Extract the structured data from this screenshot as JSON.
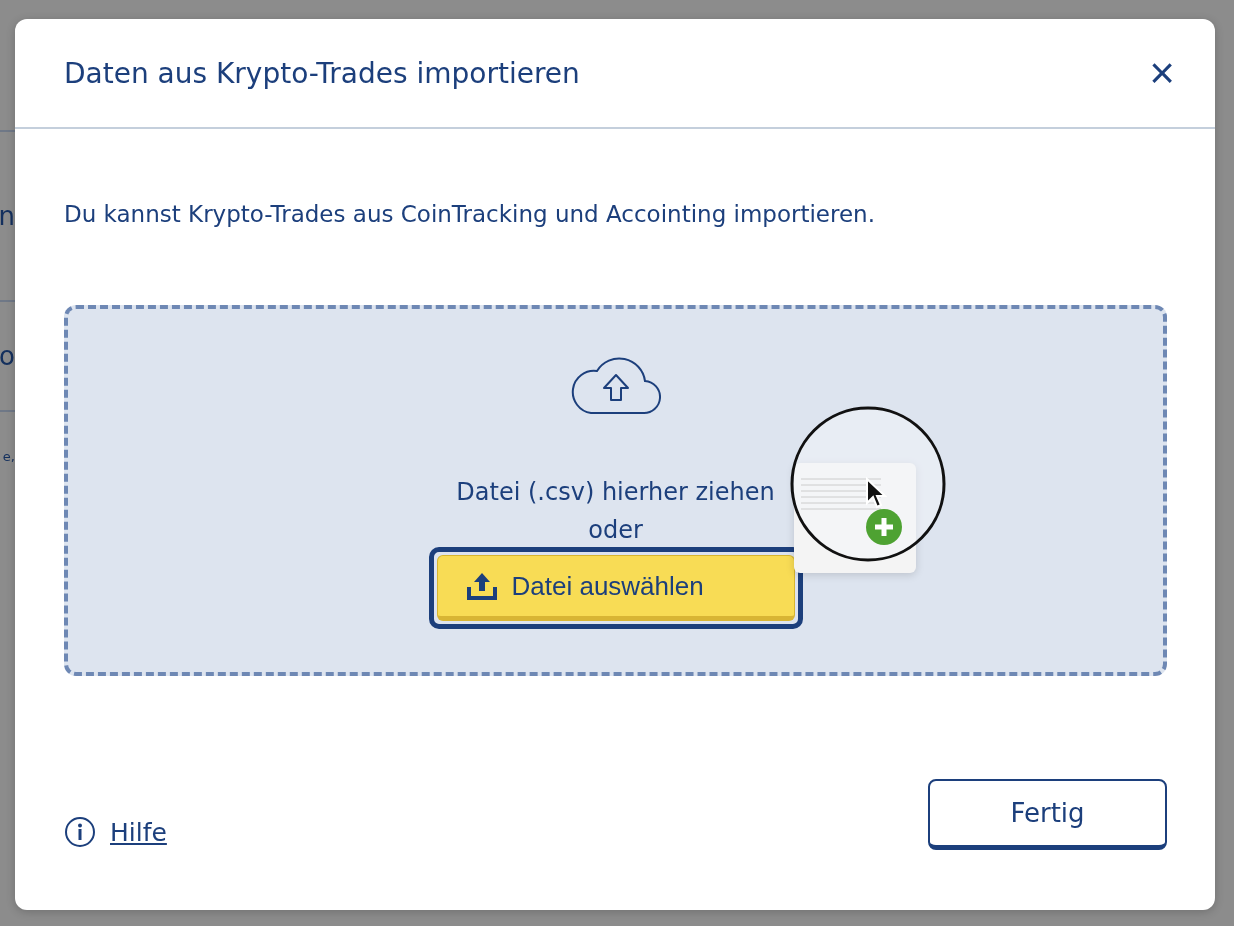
{
  "backdrop": {
    "fragments": [
      "n",
      "o",
      "e,"
    ]
  },
  "dialog": {
    "title": "Daten aus Krypto-Trades importieren",
    "close": "×",
    "description": "Du kannst Krypto-Trades aus CoinTracking und Accointing importieren.",
    "dropzone": {
      "hint": "Datei (.csv) hierher ziehen",
      "separator": "oder",
      "button": "Datei auswählen"
    },
    "help_link": "Hilfe",
    "done_button": "Fertig"
  }
}
